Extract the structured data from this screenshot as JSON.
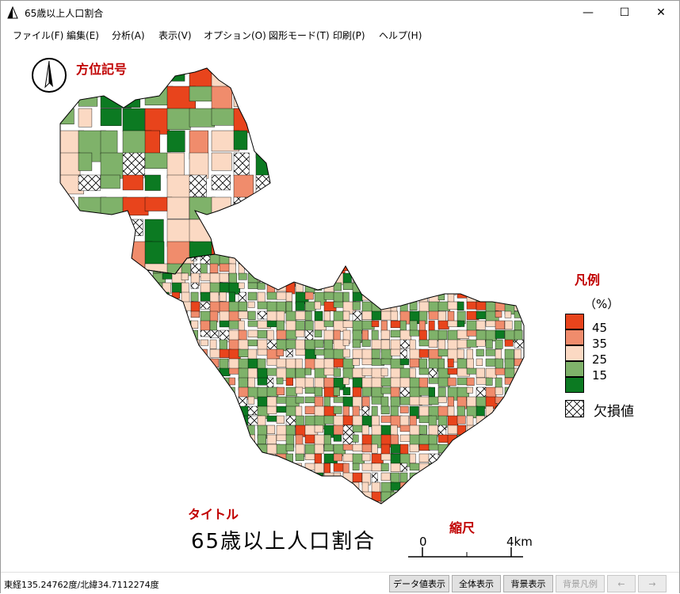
{
  "window": {
    "title": "65歳以上人口割合",
    "minimize": "—",
    "maximize": "☐",
    "close": "✕"
  },
  "menu": [
    "ファイル(F)",
    "編集(E)",
    "分析(A)",
    "表示(V)",
    "オプション(O)",
    "図形モード(T)",
    "印刷(P)",
    "ヘルプ(H)"
  ],
  "map": {
    "compass_label": "方位記号",
    "title_label": "タイトル",
    "title": "65歳以上人口割合",
    "scale_label": "縮尺",
    "scale_start": "0",
    "scale_end": "4km"
  },
  "legend": {
    "label": "凡例",
    "unit": "（%）",
    "classes": [
      {
        "value": "45",
        "color": "#e8441c"
      },
      {
        "value": "35",
        "color": "#f08c6c"
      },
      {
        "value": "25",
        "color": "#fbd9c3"
      },
      {
        "value": "15",
        "color": "#7fb26a"
      },
      {
        "value": "",
        "color": "#0c7a22"
      }
    ],
    "missing": "欠損値"
  },
  "status": {
    "coords": "東経135.24762度/北緯34.7112274度",
    "buttons": [
      "データ値表示",
      "全体表示",
      "背景表示",
      "背景凡例",
      "←",
      "→"
    ]
  }
}
